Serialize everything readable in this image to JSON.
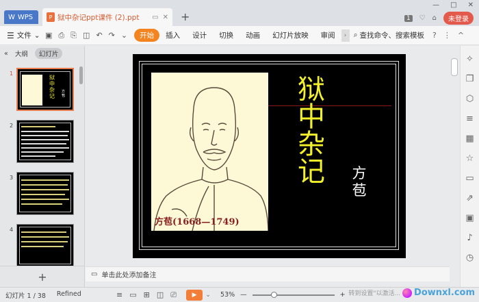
{
  "titlebar": {
    "wps_tab": "WPS",
    "doc_tab": "狱中杂记ppt课件 (2).ppt",
    "new_tab": "+",
    "badge": "1",
    "login": "未登录",
    "window_controls": [
      "—",
      "□",
      "✕"
    ]
  },
  "ribbon": {
    "file": "文件",
    "tabs": [
      "开始",
      "插入",
      "设计",
      "切换",
      "动画",
      "幻灯片放映",
      "审阅"
    ],
    "active_tab": "开始",
    "search": "查找命令、搜索模板",
    "help": "?"
  },
  "left_panel": {
    "tab_outline": "大纲",
    "tab_slides": "幻灯片",
    "collapse": "«",
    "thumbnails": [
      {
        "number": "1",
        "selected": true
      },
      {
        "number": "2",
        "selected": false
      },
      {
        "number": "3",
        "selected": false
      },
      {
        "number": "4",
        "selected": false
      }
    ],
    "add_slide": "+"
  },
  "slide": {
    "title_chars": [
      "狱",
      "中",
      "杂",
      "记"
    ],
    "author_chars": [
      "方",
      "苞"
    ],
    "caption": "方苞(1668—1749)",
    "title_color": "#f2f02a",
    "caption_color": "#8a2121"
  },
  "notes": {
    "placeholder": "单击此处添加备注"
  },
  "status": {
    "slide_indicator": "幻灯片 1 / 38",
    "theme": "Refined",
    "zoom": "53%",
    "zoom_level": 0.53,
    "zoom_minus": "—",
    "zoom_plus": "+",
    "watermark": "Downxl.com",
    "hint": "转到设置\"以激活..."
  },
  "colors": {
    "accent": "#f4841f",
    "wps_blue": "#4a78c8",
    "login_red": "#e35a4c"
  }
}
